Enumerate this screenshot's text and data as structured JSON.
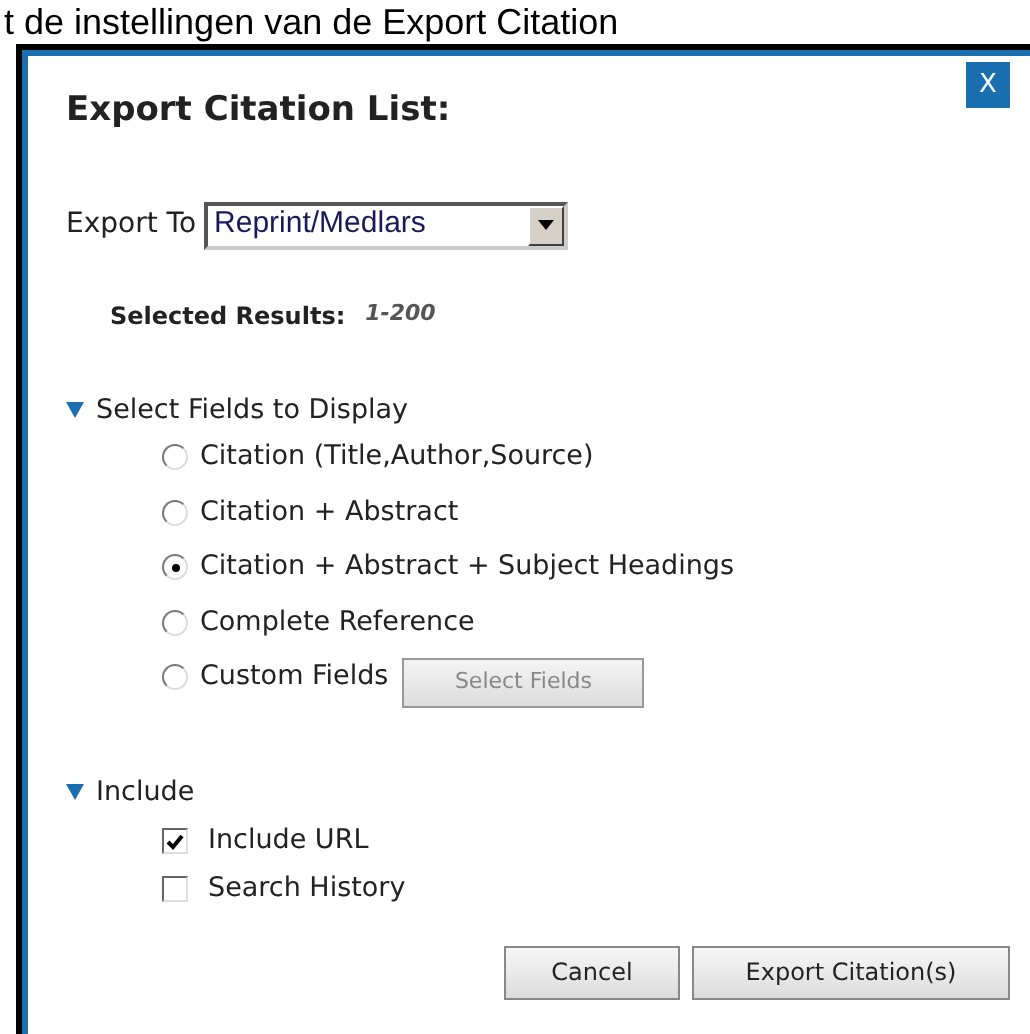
{
  "page_heading": "t de instellingen van de Export Citation",
  "dialog": {
    "title": "Export Citation List:",
    "close": "X",
    "export_to": {
      "label": "Export To",
      "value": "Reprint/Medlars"
    },
    "selected_results": {
      "label": "Selected Results:",
      "value": "1-200"
    },
    "fields_section": {
      "title": "Select Fields to Display",
      "expanded": true,
      "options": [
        {
          "label": "Citation (Title,Author,Source)",
          "selected": false
        },
        {
          "label": "Citation + Abstract",
          "selected": false
        },
        {
          "label": "Citation + Abstract + Subject Headings",
          "selected": true
        },
        {
          "label": "Complete Reference",
          "selected": false
        },
        {
          "label": "Custom Fields",
          "selected": false
        }
      ],
      "select_fields_button": {
        "label": "Select Fields",
        "disabled": true
      }
    },
    "include_section": {
      "title": "Include",
      "expanded": true,
      "options": [
        {
          "label": "Include URL",
          "checked": true
        },
        {
          "label": "Search History",
          "checked": false
        }
      ]
    },
    "buttons": [
      "Cancel",
      "Export Citation(s)"
    ]
  }
}
